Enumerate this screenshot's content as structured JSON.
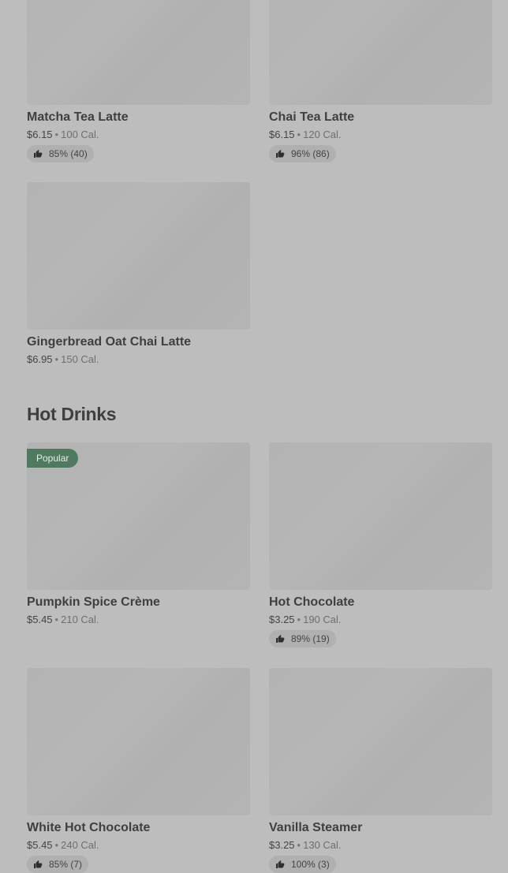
{
  "items_top": [
    {
      "name": "Matcha Tea Latte",
      "price": "$6.15",
      "sep": "•",
      "cal": "100 Cal.",
      "rating": "85% (40)"
    },
    {
      "name": "Chai Tea Latte",
      "price": "$6.15",
      "sep": "•",
      "cal": "120 Cal.",
      "rating": "96% (86)"
    },
    {
      "name": "Gingerbread Oat Chai Latte",
      "price": "$6.95",
      "sep": "•",
      "cal": "150 Cal."
    }
  ],
  "hot_drinks": {
    "title": "Hot Drinks",
    "items": [
      {
        "name": "Pumpkin Spice Crème",
        "price": "$5.45",
        "sep": "•",
        "cal": "210 Cal.",
        "badge": "Popular"
      },
      {
        "name": "Hot Chocolate",
        "price": "$3.25",
        "sep": "•",
        "cal": "190 Cal.",
        "rating": "89% (19)"
      },
      {
        "name": "White Hot Chocolate",
        "price": "$5.45",
        "sep": "•",
        "cal": "240 Cal.",
        "rating": "85% (7)"
      },
      {
        "name": "Vanilla Steamer",
        "price": "$3.25",
        "sep": "•",
        "cal": "130 Cal.",
        "rating": "100% (3)"
      }
    ]
  },
  "colors": {
    "background": "#bdbdbd",
    "popular_badge": "#4f7a60",
    "rating_pill": "#b0b0b0"
  },
  "icons": {
    "rating": "thumbs-up-icon"
  }
}
